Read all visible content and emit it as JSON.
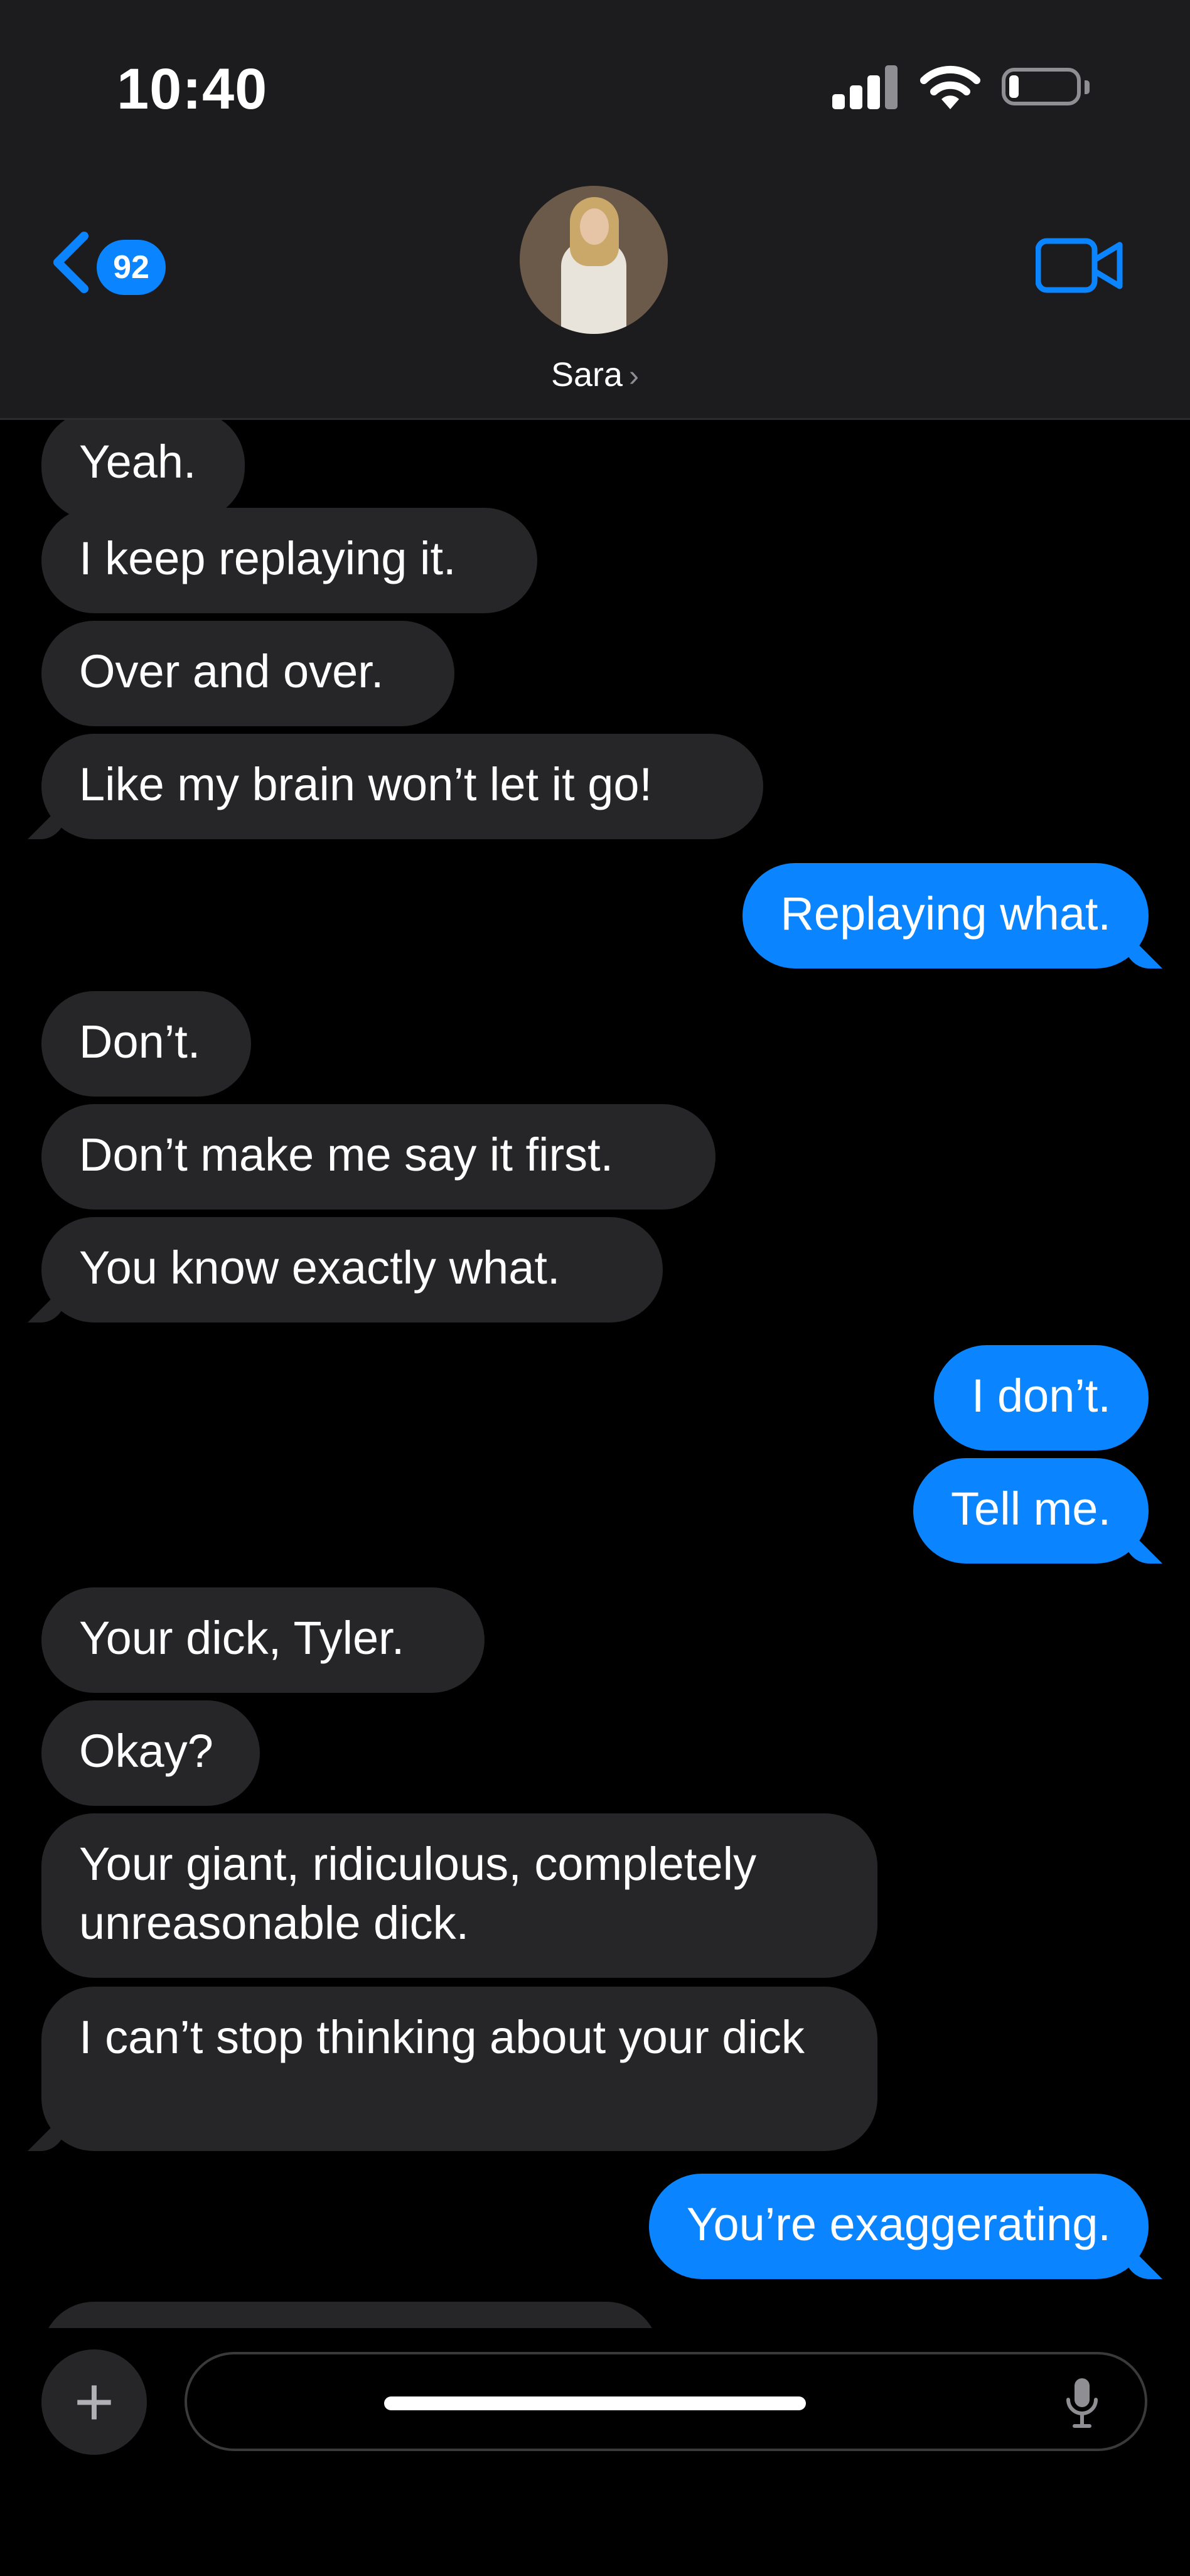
{
  "status_bar": {
    "time": "10:40",
    "icons": [
      "cellular-signal-icon",
      "wifi-icon",
      "battery-icon"
    ],
    "battery_level_fraction": 0.15
  },
  "header": {
    "back_badge_count": "92",
    "contact_name": "Sara",
    "contact_chevron": "›",
    "icons": [
      "back-chevron-icon",
      "video-camera-icon"
    ]
  },
  "colors": {
    "background": "#000000",
    "header_background": "#1c1c1e",
    "incoming_bubble": "#262628",
    "outgoing_bubble": "#0a84ff",
    "accent": "#0a84ff"
  },
  "messages": [
    {
      "direction": "incoming",
      "text": "Yeah."
    },
    {
      "direction": "incoming",
      "text": "I keep replaying it."
    },
    {
      "direction": "incoming",
      "text": "Over and over."
    },
    {
      "direction": "incoming",
      "text": "Like my brain won’t let it go!"
    },
    {
      "direction": "outgoing",
      "text": "Replaying what."
    },
    {
      "direction": "incoming",
      "text": "Don’t."
    },
    {
      "direction": "incoming",
      "text": "Don’t make me say it first."
    },
    {
      "direction": "incoming",
      "text": "You know exactly what."
    },
    {
      "direction": "outgoing",
      "text": "I don’t."
    },
    {
      "direction": "outgoing",
      "text": "Tell me."
    },
    {
      "direction": "incoming",
      "text": "Your dick, Tyler."
    },
    {
      "direction": "incoming",
      "text": "Okay?"
    },
    {
      "direction": "incoming",
      "text": "Your giant, ridiculous, completely unreasonable dick."
    },
    {
      "direction": "incoming",
      "text": "I can’t stop thinking about your dick"
    },
    {
      "direction": "outgoing",
      "text": "You’re exaggerating."
    }
  ],
  "composer": {
    "plus_label": "+",
    "input_value": "",
    "icons": [
      "plus-icon",
      "microphone-icon"
    ]
  }
}
